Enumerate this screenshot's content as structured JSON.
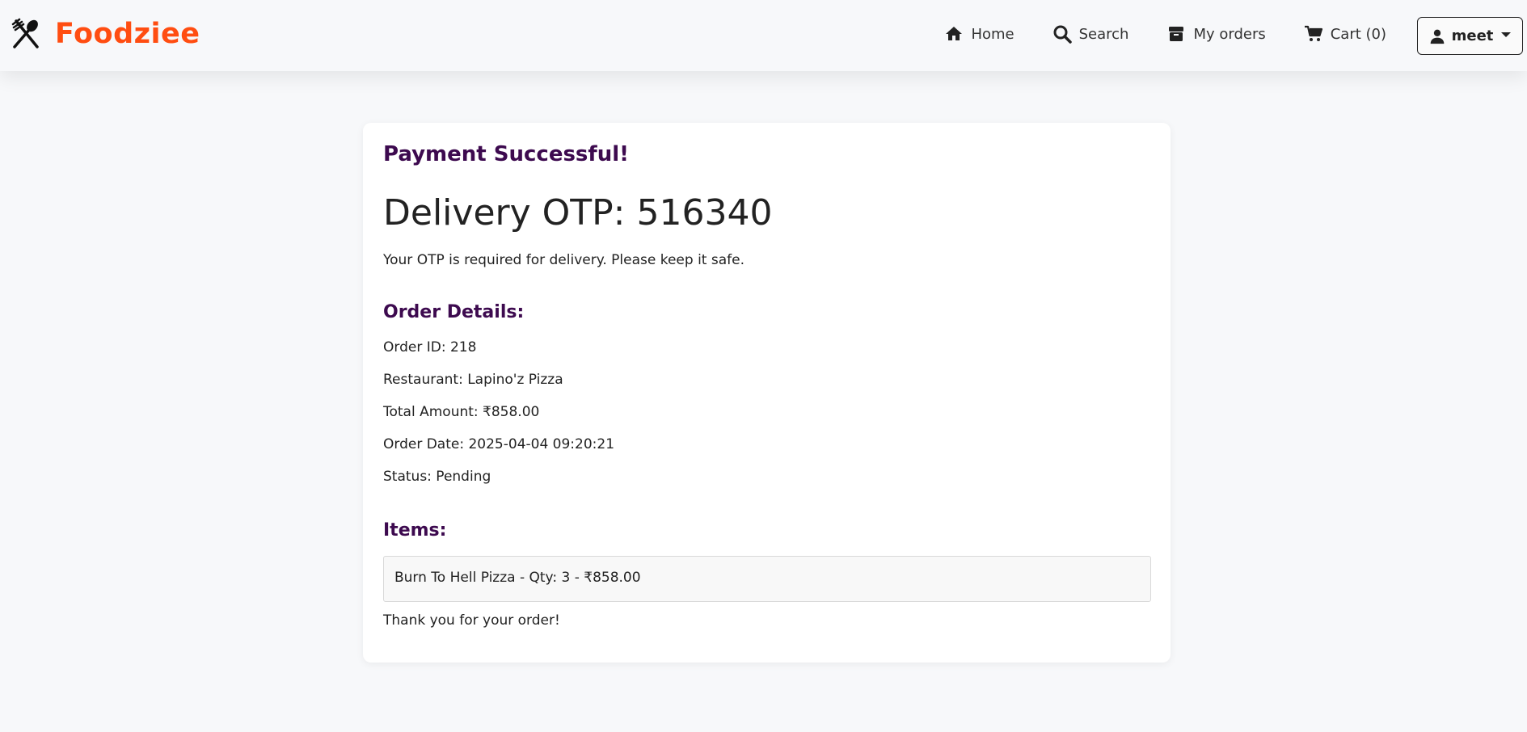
{
  "brand": {
    "name": "Foodziee",
    "color": "#ff4d11"
  },
  "nav": {
    "home": "Home",
    "search": "Search",
    "orders": "My orders",
    "cart": "Cart (0)",
    "user": "meet"
  },
  "card": {
    "title": "Payment Successful!",
    "otp": "Delivery OTP: 516340",
    "otp_note": "Your OTP is required for delivery. Please keep it safe.",
    "details_heading": "Order Details:",
    "order_id": "Order ID: 218",
    "restaurant": "Restaurant: Lapino'z Pizza",
    "total": "Total Amount: ₹858.00",
    "date": "Order Date: 2025-04-04 09:20:21",
    "status": "Status: Pending",
    "items_heading": "Items:",
    "items": [
      "Burn To Hell Pizza - Qty: 3 - ₹858.00"
    ],
    "thanks": "Thank you for your order!"
  },
  "colors": {
    "accent": "#3d0a4f",
    "background": "#f7f8fa"
  }
}
